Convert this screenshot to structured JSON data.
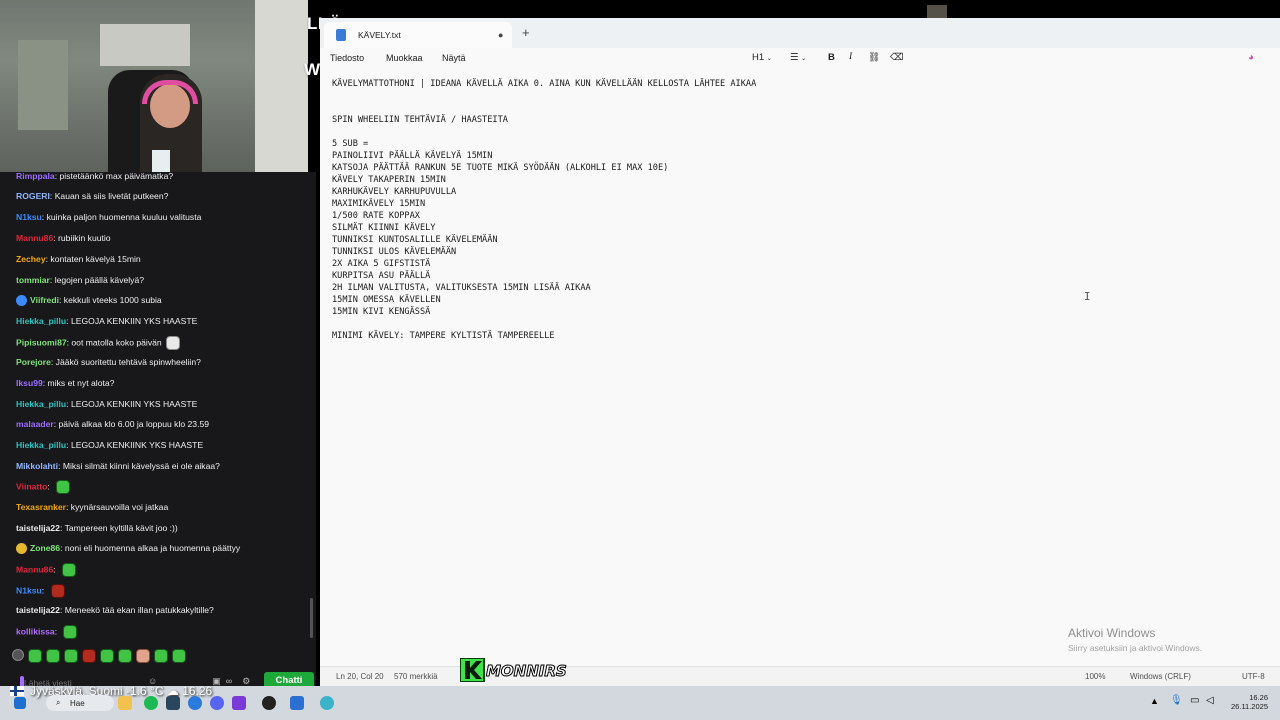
{
  "stream_overlay": {
    "text_top": "LLÄ",
    "text_mid": "WHEELIÄ"
  },
  "chat": {
    "messages": [
      {
        "user": "Rimppala",
        "text": "pistetäänkö max päivämatka?",
        "color": "#9b6dff",
        "badge": "",
        "emote": ""
      },
      {
        "user": "ROGERI",
        "text": "Kauan sä siis livetät putkeen?",
        "color": "#8fb7ff",
        "badge": "",
        "emote": ""
      },
      {
        "user": "N1ksu",
        "text": "kuinka paljon huomenna kuuluu valitusta",
        "color": "#3b8bff",
        "badge": "",
        "emote": ""
      },
      {
        "user": "Mannu86",
        "text": "rubiikin kuutio",
        "color": "#e0253c",
        "badge": "",
        "emote": ""
      },
      {
        "user": "Zechey",
        "text": "kontaten kävelyä 15min",
        "color": "#f2a900",
        "badge": "",
        "emote": ""
      },
      {
        "user": "tommiar",
        "text": "legojen päällä kävelyä?",
        "color": "#7fe37a",
        "badge": "",
        "emote": ""
      },
      {
        "user": "Viifredi",
        "text": "kekkuli vteeks 1000 subia",
        "color": "#7fe37a",
        "badge": "sub",
        "emote": ""
      },
      {
        "user": "Hiekka_pillu",
        "text": "LEGOJA KENKIIN YKS HAASTE",
        "color": "#2ec3bf",
        "badge": "",
        "emote": ""
      },
      {
        "user": "Pipisuomi87",
        "text": "oot matolla koko päivän",
        "color": "#7fe37a",
        "badge": "",
        "emote": "dog"
      },
      {
        "user": "Porejore",
        "text": "Jääkö suoritettu tehtävä spinwheeliin?",
        "color": "#7fe37a",
        "badge": "",
        "emote": ""
      },
      {
        "user": "Iksu99",
        "text": "miks et nyt alota?",
        "color": "#9b6dff",
        "badge": "",
        "emote": ""
      },
      {
        "user": "Hiekka_pillu",
        "text": "LEGOJA KENKIIN YKS HAASTE",
        "color": "#2ec3bf",
        "badge": "",
        "emote": ""
      },
      {
        "user": "malaader",
        "text": "päivä alkaa klo 6.00 ja loppuu klo 23.59",
        "color": "#9b6dff",
        "badge": "",
        "emote": ""
      },
      {
        "user": "Hiekka_pillu",
        "text": "LEGOJA KENKIINK YKS HAASTE",
        "color": "#2ec3bf",
        "badge": "",
        "emote": ""
      },
      {
        "user": "Mikkolahti",
        "text": "Miksi silmät kiinni kävelyssä ei ole aikaa?",
        "color": "#8fb7ff",
        "badge": "",
        "emote": ""
      },
      {
        "user": "Viinatto",
        "text": "",
        "color": "#e0253c",
        "badge": "",
        "emote": "green"
      },
      {
        "user": "Texasranker",
        "text": "kyynärsauvoilla voi jatkaa",
        "color": "#f2a900",
        "badge": "",
        "emote": ""
      },
      {
        "user": "taistelija22",
        "text": "Tampereen kyltillä kävit joo :))",
        "color": "#e8e8e8",
        "badge": "",
        "emote": ""
      },
      {
        "user": "Zone86",
        "text": "noni eli huomenna alkaa ja huomenna päättyy",
        "color": "#7fe37a",
        "badge": "bits",
        "emote": ""
      },
      {
        "user": "Mannu86",
        "text": "",
        "color": "#e0253c",
        "badge": "",
        "emote": "green"
      },
      {
        "user": "N1ksu",
        "text": "",
        "color": "#3b8bff",
        "badge": "",
        "emote": "red"
      },
      {
        "user": "taistelija22",
        "text": "Meneekö tää ekan illan patukkakyltille?",
        "color": "#e8e8e8",
        "badge": "",
        "emote": ""
      },
      {
        "user": "kollikissa",
        "text": "",
        "color": "#b36bff",
        "badge": "",
        "emote": "green"
      }
    ],
    "input_placeholder": "Lähetä viesti",
    "send_label": "Chatti"
  },
  "notepad": {
    "tab_title": "KÄVELY.txt",
    "menu": [
      "Tiedosto",
      "Muokkaa",
      "Näytä"
    ],
    "toolbar": {
      "heading": "H1",
      "bold": "B",
      "italic": "I"
    },
    "lines": [
      "KÄVELYMATTOTHONI | IDEANA KÄVELLÄ AIKA 0. AINA KUN KÄVELLÄÄN KELLOSTA LÄHTEE AIKAA",
      "",
      "",
      "SPIN WHEELIIN TEHTÄVIÄ / HAASTEITA",
      "",
      "5 SUB =",
      "PAINOLIIVI PÄÄLLÄ KÄVELYÄ 15MIN",
      "KATSOJA PÄÄTTÄÄ RANKUN 5E TUOTE MIKÄ SYÖDÄÄN (ALKOHLI EI MAX 10E)",
      "KÄVELY TAKAPERIN 15MIN",
      "KARHUKÄVELY KARHUPUVULLA",
      "MAXIMIKÄVELY 15MIN",
      "1/500 RATE KOPPAX",
      "SILMÄT KIINNI KÄVELY",
      "TUNNIKSI KUNTOSALILLE KÄVELEMÄÄN",
      "TUNNIKSI ULOS KÄVELEMÄÄN",
      "2X AIKA 5 GIFSTISTÄ",
      "KURPITSA ASU PÄÄLLÄ",
      "2H ILMAN VALITUSTA, VALITUKSESTA 15MIN LISÄÄ AIKAA",
      "15MIN OMESSA KÄVELLEN",
      "15MIN KIVI KENGÄSSÄ",
      "",
      "MINIMI KÄVELY: TAMPERE KYLTISTÄ TAMPEREELLE"
    ],
    "activation_title": "Aktivoi Windows",
    "activation_sub": "Siirry asetuksiin ja aktivoi Windows.",
    "status": {
      "position": "Ln 20, Col 20",
      "chars": "570 merkkiä",
      "zoom": "100%",
      "line_ending": "Windows (CRLF)",
      "encoding": "UTF-8"
    }
  },
  "logo_text": "MONNIRS",
  "taskbar": {
    "weather": "Jyväskylä, Suomi  -1.6 °C",
    "weather_time": "16.26",
    "search_label": "Hae",
    "clock_time": "16.26",
    "clock_date": "26.11.2025"
  }
}
